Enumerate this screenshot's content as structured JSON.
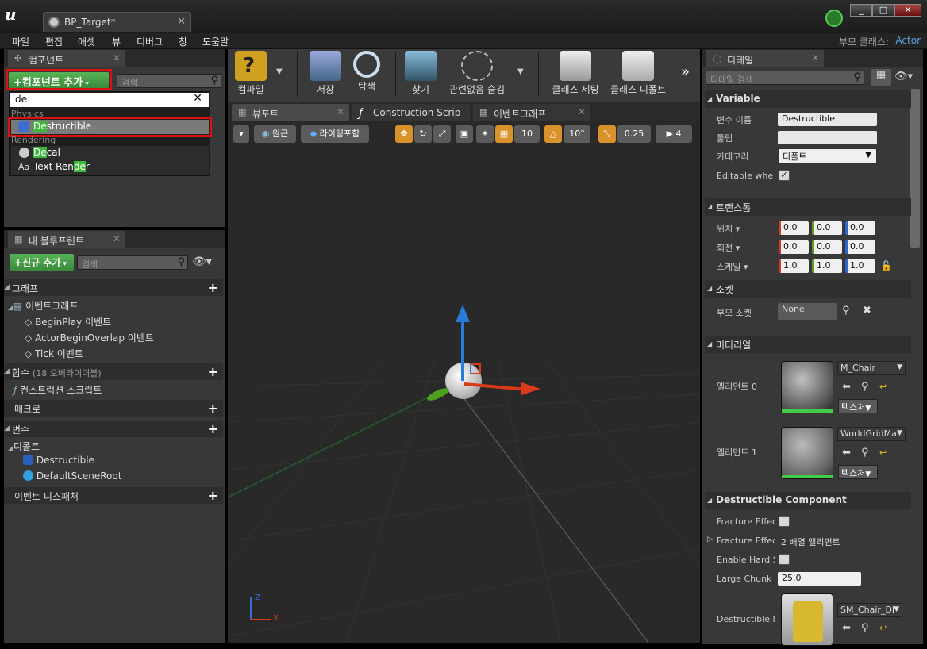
{
  "window": {
    "tab_title": "BP_Target*",
    "min": "_",
    "max": "□",
    "close": "✕"
  },
  "menu": [
    "파일",
    "편집",
    "애셋",
    "뷰",
    "디버그",
    "창",
    "도움말"
  ],
  "parent_class": {
    "label": "부모 클래스:",
    "value": "Actor"
  },
  "components_panel": {
    "tab": "컴포넌트",
    "add_button": "컴포넌트 추가",
    "search_placeholder": "검색",
    "filter_value": "de",
    "dropdown": {
      "categories": [
        {
          "name": "Physics",
          "items": [
            {
              "label": "Destructible",
              "highlight": "De",
              "rest": "structible"
            }
          ]
        },
        {
          "name": "Rendering",
          "items": [
            {
              "label": "Decal",
              "highlight": "De",
              "rest": "cal"
            },
            {
              "label": "Text Render",
              "pre": "Text Ren",
              "highlight": "de",
              "rest": "r"
            }
          ]
        }
      ]
    }
  },
  "blueprint_panel": {
    "tab": "내 블루프린트",
    "add_new": "신규 추가",
    "search_placeholder": "검색",
    "sections": {
      "graph": "그래프",
      "event_graph": "이벤트그래프",
      "events": [
        "BeginPlay 이벤트",
        "ActorBeginOverlap 이벤트",
        "Tick 이벤트"
      ],
      "functions": "함수",
      "functions_note": "(18 오버라이더블)",
      "construction_script": "컨스트럭션 스크립트",
      "macros": "매크로",
      "variables": "변수",
      "default_cat": "디폴트",
      "vars": [
        "Destructible",
        "DefaultSceneRoot"
      ],
      "dispatchers": "이벤트 디스패처"
    }
  },
  "toolbar": {
    "compile": "컴파일",
    "save": "저장",
    "browse": "탐색",
    "find": "찾기",
    "hide_unrelated": "관련없음 숨김",
    "class_settings": "클래스 세팅",
    "class_defaults": "클래스 디폴트"
  },
  "editor_tabs": [
    "뷰포트",
    "Construction Scrip",
    "이벤트그래프"
  ],
  "viewport": {
    "perspective": "원근",
    "lit": "라이팅포함",
    "grid_snap": "10",
    "rot_snap": "10°",
    "scale_snap": "0.25",
    "cam_speed": "4",
    "axis_z": "Z",
    "axis_x": "X"
  },
  "details": {
    "tab": "디테일",
    "search_placeholder": "디테일 검색",
    "variable_section": "Variable",
    "var_name_label": "변수 이름",
    "var_name_value": "Destructible",
    "tooltip_label": "툴팁",
    "tooltip_value": "",
    "category_label": "카테고리",
    "category_value": "디폴트",
    "editable_label": "Editable when",
    "transform_section": "트랜스폼",
    "location_label": "위치",
    "location": [
      "0.0",
      "0.0",
      "0.0"
    ],
    "rotation_label": "회전",
    "rotation": [
      "0.0",
      "0.0",
      "0.0"
    ],
    "scale_label": "스케일",
    "scale": [
      "1.0",
      "1.0",
      "1.0"
    ],
    "socket_section": "소켓",
    "parent_socket_label": "부모 소켓",
    "parent_socket_value": "None",
    "material_section": "머티리얼",
    "element0_label": "엘리먼트 0",
    "element0_mat": "M_Chair",
    "element1_label": "엘리먼트 1",
    "element1_mat": "WorldGridMat",
    "texture_btn": "텍스처",
    "destructible_section": "Destructible Component",
    "fracture1_label": "Fracture Effect",
    "fracture2_label": "Fracture Effect",
    "fracture2_value": "2 배열 엘리먼트",
    "enable_hard_label": "Enable Hard Sl",
    "large_chunk_label": "Large Chunk T",
    "large_chunk_value": "25.0",
    "destructible_mesh_label": "Destructible M",
    "destructible_mesh_value": "SM_Chair_DM"
  }
}
